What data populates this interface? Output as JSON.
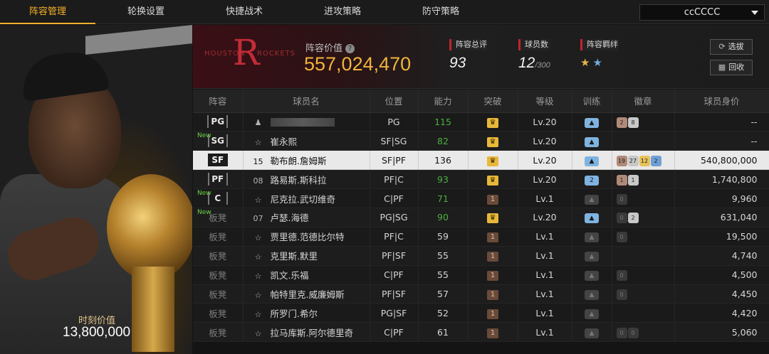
{
  "tabs": [
    {
      "label": "阵容管理"
    },
    {
      "label": "轮换设置"
    },
    {
      "label": "快捷战术"
    },
    {
      "label": "进攻策略"
    },
    {
      "label": "防守策略"
    }
  ],
  "team_select": {
    "value": "ccCCCC"
  },
  "left_panel": {
    "value_label": "时刻价值",
    "value": "13,800,000"
  },
  "header": {
    "logo_word_left": "HOUSTON",
    "logo_word_right": "ROCKETS",
    "lineup_value_label": "阵容价值",
    "lineup_value": "557,024,470",
    "overall_label": "阵容总评",
    "overall_value": "93",
    "players_label": "球员数",
    "players_value": "12",
    "players_max": "/300",
    "bond_label": "阵容羁绊",
    "select_button": "选拔",
    "recycle_button": "回收"
  },
  "table": {
    "headers": [
      "阵容",
      "球员名",
      "位置",
      "能力",
      "突破",
      "等级",
      "训练",
      "徽章",
      "球员身价"
    ],
    "rows": [
      {
        "slot": "PG",
        "num": "",
        "name": "",
        "pos": "PG",
        "ability": "115",
        "level": "Lv.20",
        "badges": [
          "2",
          "8"
        ],
        "value": "--"
      },
      {
        "slot": "SG",
        "new": "New",
        "num": "",
        "name": "崔永熙",
        "pos": "SF|SG",
        "ability": "82",
        "level": "Lv.20",
        "badges": [],
        "value": "--"
      },
      {
        "slot": "SF",
        "num": "15",
        "name": "勒布朗.詹姆斯",
        "pos": "SF|PF",
        "ability": "136",
        "level": "Lv.20",
        "badges": [
          "19",
          "27",
          "12",
          "2"
        ],
        "value": "540,800,000"
      },
      {
        "slot": "PF",
        "num": "08",
        "name": "路易斯.斯科拉",
        "pos": "PF|C",
        "ability": "93",
        "level": "Lv.20",
        "badges": [
          "1",
          "1"
        ],
        "value": "1,740,800"
      },
      {
        "slot": "C",
        "new": "New",
        "num": "",
        "name": "尼克拉.武切维奇",
        "pos": "C|PF",
        "ability": "71",
        "level": "Lv.1",
        "badges": [
          "0"
        ],
        "value": "9,960"
      },
      {
        "slot": "板凳",
        "new": "New",
        "num": "07",
        "name": "卢瑟.海德",
        "pos": "PG|SG",
        "ability": "90",
        "level": "Lv.20",
        "badges": [
          "0",
          "2"
        ],
        "value": "631,040"
      },
      {
        "slot": "板凳",
        "num": "",
        "name": "贾里德.范德比尔特",
        "pos": "PF|C",
        "ability": "59",
        "level": "Lv.1",
        "badges": [
          "0"
        ],
        "value": "19,500"
      },
      {
        "slot": "板凳",
        "num": "",
        "name": "克里斯.默里",
        "pos": "PF|SF",
        "ability": "55",
        "level": "Lv.1",
        "badges": [],
        "value": "4,740"
      },
      {
        "slot": "板凳",
        "num": "",
        "name": "凯文.乐福",
        "pos": "C|PF",
        "ability": "55",
        "level": "Lv.1",
        "badges": [
          "0"
        ],
        "value": "4,500"
      },
      {
        "slot": "板凳",
        "num": "",
        "name": "帕特里克.威廉姆斯",
        "pos": "PF|SF",
        "ability": "57",
        "level": "Lv.1",
        "badges": [
          "0"
        ],
        "value": "4,450"
      },
      {
        "slot": "板凳",
        "num": "",
        "name": "所罗门.希尔",
        "pos": "PG|SF",
        "ability": "52",
        "level": "Lv.1",
        "badges": [],
        "value": "4,420"
      },
      {
        "slot": "板凳",
        "num": "",
        "name": "拉马库斯.阿尔德里奇",
        "pos": "C|PF",
        "ability": "61",
        "level": "Lv.1",
        "badges": [
          "0",
          "0"
        ],
        "value": "5,060"
      }
    ]
  }
}
